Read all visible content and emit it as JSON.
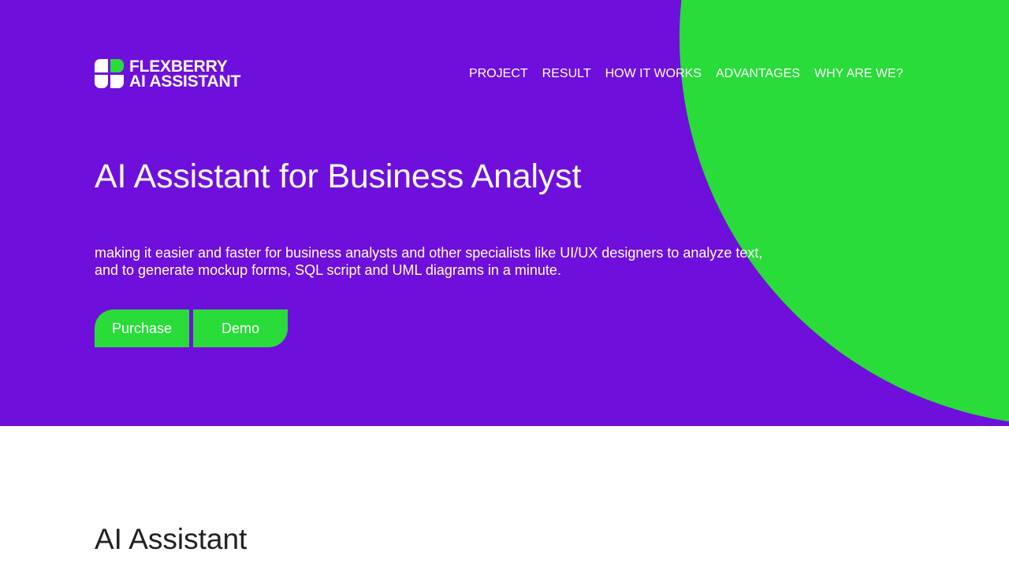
{
  "brand": {
    "line1": "FLEXBERRY",
    "line2": "AI ASSISTANT",
    "colors": {
      "primary": "#6f0fdb",
      "accent": "#29dc3a",
      "text": "#ffffff"
    }
  },
  "nav": {
    "items": [
      {
        "label": "PROJECT"
      },
      {
        "label": "RESULT"
      },
      {
        "label": "HOW IT WORKS"
      },
      {
        "label": "ADVANTAGES"
      },
      {
        "label": "WHY ARE WE?"
      }
    ]
  },
  "hero": {
    "title": "AI Assistant for Business Analyst",
    "subtitle_line1": "making it easier and faster for business analysts and other specialists like UI/UX designers to analyze text,",
    "subtitle_line2": "and to generate mockup forms, SQL script and UML diagrams in a minute.",
    "purchase_label": "Purchase",
    "demo_label": "Demo"
  },
  "section": {
    "title": "AI Assistant"
  }
}
